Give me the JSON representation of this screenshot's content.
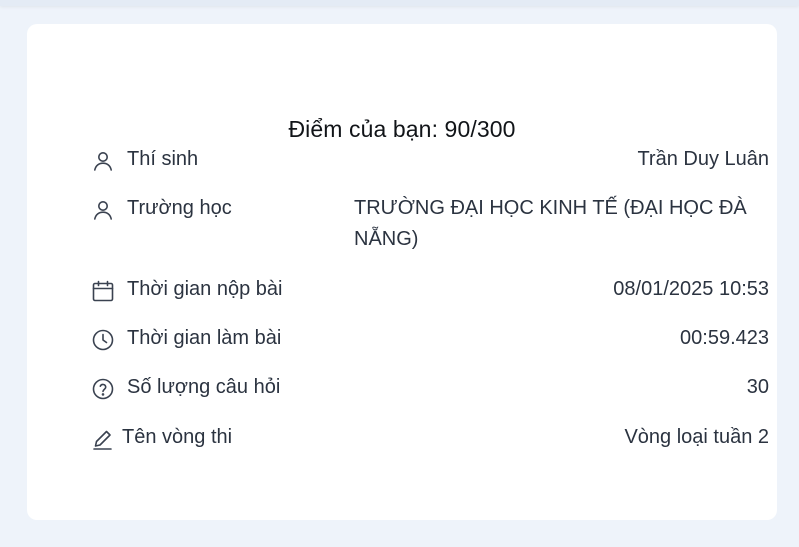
{
  "result": {
    "score_label": "Điểm của bạn: 90/300"
  },
  "details": {
    "candidate": {
      "label": "Thí sinh",
      "value": "Trần Duy Luân",
      "icon": "user-icon"
    },
    "school": {
      "label": "Trường học",
      "value": "TRƯỜNG ĐẠI HỌC KINH TẾ (ĐẠI HỌC ĐÀ NẴNG)",
      "icon": "user-icon"
    },
    "submit_time": {
      "label": "Thời gian nộp bài",
      "value": "08/01/2025 10:53",
      "icon": "calendar-icon"
    },
    "duration": {
      "label": "Thời gian làm bài",
      "value": "00:59.423",
      "icon": "clock-icon"
    },
    "question_count": {
      "label": "Số lượng câu hỏi",
      "value": "30",
      "icon": "question-circle-icon"
    },
    "round_name": {
      "label": "Tên vòng thi",
      "value": "Vòng loại tuần 2",
      "icon": "pencil-icon"
    }
  },
  "colors": {
    "background": "#eef3fa",
    "card": "#ffffff",
    "text": "#2b3340",
    "title": "#111418"
  }
}
